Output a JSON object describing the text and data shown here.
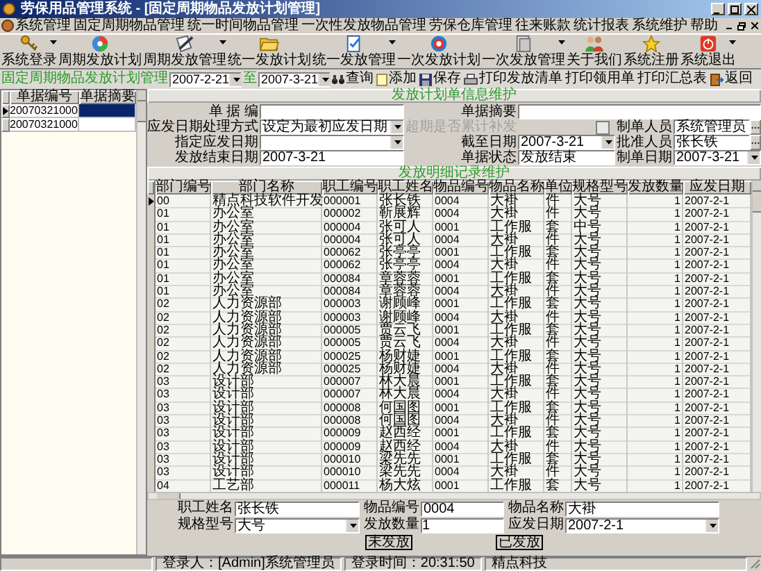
{
  "window": {
    "title": "劳保用品管理系统 - [固定周期物品发放计划管理]"
  },
  "menu": [
    "系统管理",
    "固定周期物品管理",
    "统一时间物品管理",
    "一次性发放物品管理",
    "劳保仓库管理",
    "往来账款",
    "统计报表",
    "系统维护",
    "帮助"
  ],
  "toolbar": [
    {
      "label": "系统登录",
      "dropdown": true
    },
    {
      "label": "周期发放计划",
      "dropdown": false
    },
    {
      "label": "周期发放管理",
      "dropdown": true
    },
    {
      "label": "统一发放计划",
      "dropdown": false
    },
    {
      "label": "统一发放管理",
      "dropdown": true
    },
    {
      "label": "一次发放计划",
      "dropdown": false
    },
    {
      "label": "一次发放管理",
      "dropdown": true
    },
    {
      "label": "关于我们",
      "dropdown": false
    },
    {
      "label": "系统注册",
      "dropdown": false
    },
    {
      "label": "系统退出",
      "dropdown": true
    }
  ],
  "filter_bar": {
    "title": "固定周期物品发放计划管理",
    "date_from": "2007-2-21",
    "separator": "至",
    "date_to": "2007-3-21",
    "actions": [
      "查询",
      "添加",
      "保存",
      "打印发放清单",
      "打印领用单",
      "打印汇总表",
      "返回"
    ]
  },
  "plan_list": {
    "columns": [
      "单据编号",
      "单据摘要"
    ],
    "rows": [
      {
        "number": "20070321000",
        "selected": true
      },
      {
        "number": "20070321000",
        "selected": false
      }
    ]
  },
  "plan_form": {
    "title": "发放计划单信息维护",
    "rows": [
      [
        {
          "label": "单 据 编",
          "kind": "text"
        },
        {
          "label": "单据摘要",
          "kind": "text"
        }
      ],
      [
        {
          "label": "应发日期处理方式",
          "kind": "select",
          "value": "设定为最初应发日期"
        },
        {
          "label": "超期是否累计补发",
          "kind": "checkbox",
          "checked": false,
          "disabled": true
        },
        {
          "label": "制单人员",
          "kind": "lookup",
          "value": "系统管理员"
        }
      ],
      [
        {
          "label": "指定应发日期",
          "kind": "select"
        },
        {
          "label": "截至日期",
          "kind": "select",
          "value": "2007-3-21"
        },
        {
          "label": "批准人员",
          "kind": "lookup",
          "value": "张长铁"
        }
      ],
      [
        {
          "label": "发放结束日期",
          "kind": "text",
          "value": "2007-3-21"
        },
        {
          "label": "单据状态",
          "kind": "text",
          "value": "发放结束"
        },
        {
          "label": "制单日期",
          "kind": "select",
          "value": "2007-3-21"
        }
      ]
    ]
  },
  "details": {
    "title": "发放明细记录维护",
    "columns": [
      "部门编号",
      "部门名称",
      "职工编号",
      "职工姓名",
      "物品编号",
      "物品名称",
      "单位",
      "规格型号",
      "发放数量",
      "应发日期"
    ],
    "rows": [
      {
        "cells": [
          "00",
          "精点科技软件开发",
          "000001",
          "张长铁",
          "0004",
          "大褂",
          "件",
          "大号",
          "1",
          "2007-2-1"
        ],
        "selected": true
      },
      {
        "cells": [
          "01",
          "办公室",
          "000002",
          "靳展辉",
          "0004",
          "大褂",
          "件",
          "大号",
          "1",
          "2007-2-1"
        ],
        "selected": false
      },
      {
        "cells": [
          "01",
          "办公室",
          "000004",
          "张可人",
          "0001",
          "工作服",
          "套",
          "中号",
          "1",
          "2007-2-1"
        ],
        "selected": false
      },
      {
        "cells": [
          "01",
          "办公室",
          "000004",
          "张可人",
          "0004",
          "大褂",
          "件",
          "大号",
          "1",
          "2007-2-1"
        ],
        "selected": false
      },
      {
        "cells": [
          "01",
          "办公室",
          "000062",
          "张亭亭",
          "0001",
          "工作服",
          "套",
          "大号",
          "1",
          "2007-2-1"
        ],
        "selected": false
      },
      {
        "cells": [
          "01",
          "办公室",
          "000062",
          "张亭亭",
          "0004",
          "大褂",
          "件",
          "大号",
          "1",
          "2007-2-1"
        ],
        "selected": false
      },
      {
        "cells": [
          "01",
          "办公室",
          "000084",
          "章蓉蓉",
          "0001",
          "工作服",
          "套",
          "大号",
          "1",
          "2007-2-1"
        ],
        "selected": false
      },
      {
        "cells": [
          "01",
          "办公室",
          "000084",
          "章蓉蓉",
          "0004",
          "大褂",
          "件",
          "大号",
          "1",
          "2007-2-1"
        ],
        "selected": false
      },
      {
        "cells": [
          "02",
          "人力资源部",
          "000003",
          "谢顾峰",
          "0001",
          "工作服",
          "套",
          "大号",
          "1",
          "2007-2-1"
        ],
        "selected": false
      },
      {
        "cells": [
          "02",
          "人力资源部",
          "000003",
          "谢顾峰",
          "0004",
          "大褂",
          "件",
          "大号",
          "1",
          "2007-2-1"
        ],
        "selected": false
      },
      {
        "cells": [
          "02",
          "人力资源部",
          "000005",
          "贾云飞",
          "0001",
          "工作服",
          "套",
          "大号",
          "1",
          "2007-2-1"
        ],
        "selected": false
      },
      {
        "cells": [
          "02",
          "人力资源部",
          "000005",
          "贾云飞",
          "0004",
          "大褂",
          "件",
          "大号",
          "1",
          "2007-2-1"
        ],
        "selected": false
      },
      {
        "cells": [
          "02",
          "人力资源部",
          "000025",
          "杨财婕",
          "0001",
          "工作服",
          "套",
          "大号",
          "1",
          "2007-2-1"
        ],
        "selected": false
      },
      {
        "cells": [
          "02",
          "人力资源部",
          "000025",
          "杨财婕",
          "0004",
          "大褂",
          "件",
          "大号",
          "1",
          "2007-2-1"
        ],
        "selected": false
      },
      {
        "cells": [
          "03",
          "设计部",
          "000007",
          "林大晨",
          "0001",
          "工作服",
          "套",
          "大号",
          "1",
          "2007-2-1"
        ],
        "selected": false
      },
      {
        "cells": [
          "03",
          "设计部",
          "000007",
          "林大晨",
          "0004",
          "大褂",
          "件",
          "大号",
          "1",
          "2007-2-1"
        ],
        "selected": false
      },
      {
        "cells": [
          "03",
          "设计部",
          "000008",
          "何国图",
          "0001",
          "工作服",
          "套",
          "大号",
          "1",
          "2007-2-1"
        ],
        "selected": false
      },
      {
        "cells": [
          "03",
          "设计部",
          "000008",
          "何国图",
          "0004",
          "大褂",
          "件",
          "大号",
          "1",
          "2007-2-1"
        ],
        "selected": false
      },
      {
        "cells": [
          "03",
          "设计部",
          "000009",
          "赵西经",
          "0001",
          "工作服",
          "套",
          "大号",
          "1",
          "2007-2-1"
        ],
        "selected": false
      },
      {
        "cells": [
          "03",
          "设计部",
          "000009",
          "赵西经",
          "0004",
          "大褂",
          "件",
          "大号",
          "1",
          "2007-2-1"
        ],
        "selected": false
      },
      {
        "cells": [
          "03",
          "设计部",
          "000010",
          "梁先先",
          "0001",
          "工作服",
          "套",
          "大号",
          "1",
          "2007-2-1"
        ],
        "selected": false
      },
      {
        "cells": [
          "03",
          "设计部",
          "000010",
          "梁先先",
          "0004",
          "大褂",
          "件",
          "大号",
          "1",
          "2007-2-1"
        ],
        "selected": false
      },
      {
        "cells": [
          "04",
          "工艺部",
          "000011",
          "杨大炫",
          "0001",
          "工作服",
          "套",
          "大号",
          "1",
          "2007-2-1"
        ],
        "selected": false
      }
    ]
  },
  "detail_form": {
    "rows": [
      [
        {
          "label": "职工姓名",
          "kind": "text",
          "value": "张长铁"
        },
        {
          "label": "物品编号",
          "kind": "text",
          "value": "0004"
        },
        {
          "label": "物品名称",
          "kind": "text",
          "value": "大褂"
        }
      ],
      [
        {
          "label": "规格型号",
          "kind": "select",
          "value": "大号"
        },
        {
          "label": "发放数量",
          "kind": "number",
          "value": "1"
        },
        {
          "label": "应发日期",
          "kind": "select",
          "value": "2007-2-1"
        }
      ]
    ]
  },
  "buttons": [
    "未发放",
    "已发放"
  ],
  "status_bar": [
    "登录人：[Admin]系统管理员",
    "登录时间：20:31:50",
    "精点科技"
  ]
}
